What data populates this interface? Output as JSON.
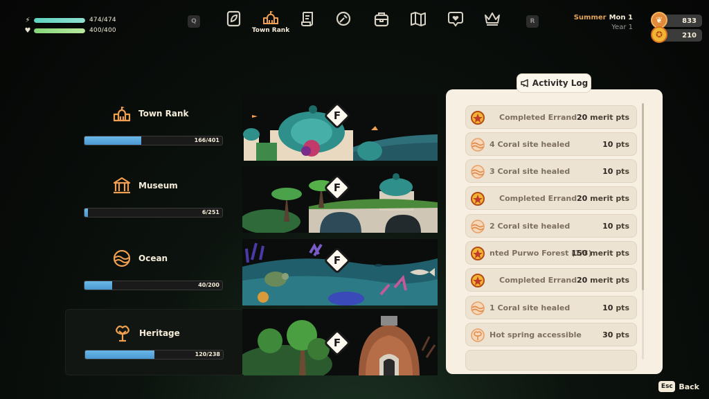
{
  "hud": {
    "energy": {
      "value": "474",
      "max": "474",
      "fraction": 1.0
    },
    "health": {
      "value": "400",
      "max": "400",
      "fraction": 1.0
    }
  },
  "nav": {
    "left_key": "Q",
    "right_key": "R",
    "items": [
      {
        "icon": "leaf-journal-icon"
      },
      {
        "icon": "town-rank-icon",
        "label": "Town Rank",
        "active": true
      },
      {
        "icon": "scroll-icon"
      },
      {
        "icon": "wrench-icon"
      },
      {
        "icon": "backpack-icon"
      },
      {
        "icon": "map-icon"
      },
      {
        "icon": "heart-chat-icon"
      },
      {
        "icon": "crown-icon"
      }
    ]
  },
  "date": {
    "season": "Summer",
    "day": "Mon 1",
    "year": "Year 1"
  },
  "currency": [
    {
      "name": "merit-coin",
      "value": "833",
      "color": "#e08a3a"
    },
    {
      "name": "rank-medal",
      "value": "210",
      "color": "#f0b534"
    }
  ],
  "categories": [
    {
      "name": "Town Rank",
      "current": "166",
      "total": "401",
      "progress_text": "166/401",
      "fraction": 0.414,
      "rank": "F"
    },
    {
      "name": "Museum",
      "current": "6",
      "total": "251",
      "progress_text": "6/251",
      "fraction": 0.024,
      "rank": "F"
    },
    {
      "name": "Ocean",
      "current": "40",
      "total": "200",
      "progress_text": "40/200",
      "fraction": 0.2,
      "rank": "F"
    },
    {
      "name": "Heritage",
      "current": "120",
      "total": "238",
      "progress_text": "120/238",
      "fraction": 0.504,
      "rank": "F",
      "selected": true
    }
  ],
  "activity_log": {
    "title": "Activity Log",
    "entries": [
      {
        "icon": "medal-icon",
        "text": "Completed Errand",
        "points": "20",
        "unit": "merit pts"
      },
      {
        "icon": "ocean-icon",
        "text": "4 Coral site healed",
        "points": "10",
        "unit": "pts"
      },
      {
        "icon": "ocean-icon",
        "text": "3 Coral site healed",
        "points": "10",
        "unit": "pts"
      },
      {
        "icon": "medal-icon",
        "text": "Completed Errand",
        "points": "20",
        "unit": "merit pts"
      },
      {
        "icon": "ocean-icon",
        "text": "2 Coral site healed",
        "points": "10",
        "unit": "pts"
      },
      {
        "icon": "medal-icon",
        "text": "nted Purwo Forest (1/3)",
        "points": "150",
        "unit": "merit pts"
      },
      {
        "icon": "medal-icon",
        "text": "Completed Errand",
        "points": "20",
        "unit": "merit pts"
      },
      {
        "icon": "ocean-icon",
        "text": "1 Coral site healed",
        "points": "10",
        "unit": "pts"
      },
      {
        "icon": "heritage-icon",
        "text": "Hot spring accessible",
        "points": "30",
        "unit": "pts"
      }
    ]
  },
  "back": {
    "key": "Esc",
    "label": "Back"
  }
}
